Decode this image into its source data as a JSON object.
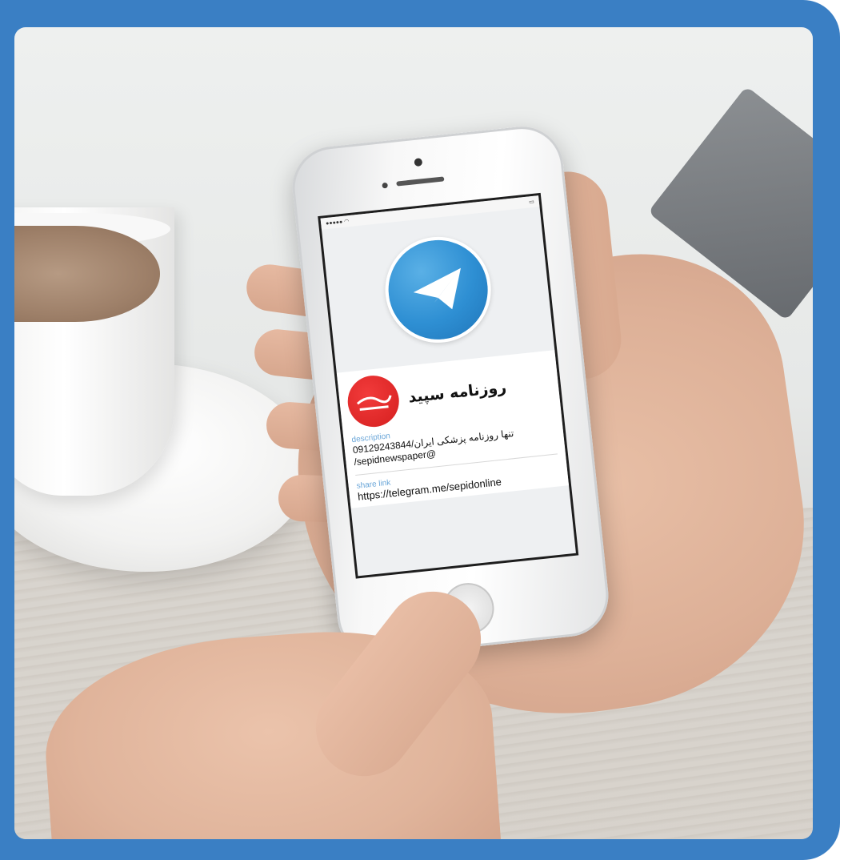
{
  "channel": {
    "name": "روزنامه سپید"
  },
  "description": {
    "label": "description",
    "line1": "تنها روزنامه پزشکی ایران/09129243844",
    "line2": "/sepidnewspaper@"
  },
  "share_link": {
    "label": "share link",
    "url": "https://telegram.me/sepidonline"
  },
  "icons": {
    "app": "telegram-icon",
    "avatar": "sepid-newspaper-logo"
  },
  "colors": {
    "frame": "#3a7fc4",
    "telegram": "#2e8fd3",
    "avatar": "#d51f1f",
    "section_label": "#6aa6d8"
  }
}
